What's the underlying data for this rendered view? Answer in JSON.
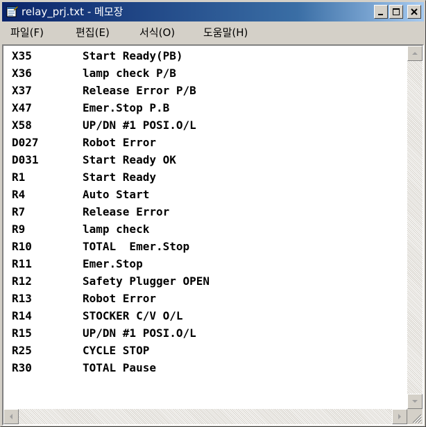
{
  "window": {
    "title": "relay_prj.txt - 메모장",
    "app_icon": "notepad-icon",
    "controls": [
      "minimize-icon",
      "maximize-icon",
      "close-icon"
    ]
  },
  "menu": [
    {
      "label": "파일",
      "accel": "(F)",
      "accel_underline": "F"
    },
    {
      "label": "편집",
      "accel": "(E)",
      "accel_underline": "E"
    },
    {
      "label": "서식",
      "accel": "(O)",
      "accel_underline": "O"
    },
    {
      "label": "도움말",
      "accel": "(H)",
      "accel_underline": "H"
    }
  ],
  "document": {
    "lines": [
      {
        "code": "X35",
        "desc": "Start Ready(PB)"
      },
      {
        "code": "X36",
        "desc": "lamp check P/B"
      },
      {
        "code": "X37",
        "desc": "Release Error P/B"
      },
      {
        "code": "X47",
        "desc": "Emer.Stop P.B"
      },
      {
        "code": "X58",
        "desc": "UP/DN #1 POSI.O/L"
      },
      {
        "code": "D027",
        "desc": "Robot Error"
      },
      {
        "code": "D031",
        "desc": "Start Ready OK"
      },
      {
        "code": "R1",
        "desc": "Start Ready"
      },
      {
        "code": "R4",
        "desc": "Auto Start"
      },
      {
        "code": "R7",
        "desc": "Release Error"
      },
      {
        "code": "R9",
        "desc": "lamp check"
      },
      {
        "code": "R10",
        "desc": "TOTAL  Emer.Stop"
      },
      {
        "code": "R11",
        "desc": "Emer.Stop"
      },
      {
        "code": "R12",
        "desc": "Safety Plugger OPEN"
      },
      {
        "code": "R13",
        "desc": "Robot Error"
      },
      {
        "code": "R14",
        "desc": "STOCKER C/V O/L"
      },
      {
        "code": "R15",
        "desc": "UP/DN #1 POSI.O/L"
      },
      {
        "code": "R25",
        "desc": "CYCLE STOP"
      },
      {
        "code": "R30",
        "desc": "TOTAL Pause"
      }
    ]
  },
  "scrollbars": {
    "vertical": {
      "up": "scroll-up-arrow-icon",
      "down": "scroll-down-arrow-icon"
    },
    "horizontal": {
      "left": "scroll-left-arrow-icon",
      "right": "scroll-right-arrow-icon"
    }
  },
  "colors": {
    "titlebar_start": "#0a246a",
    "titlebar_end": "#a6caf0",
    "face": "#d4d0c8"
  }
}
